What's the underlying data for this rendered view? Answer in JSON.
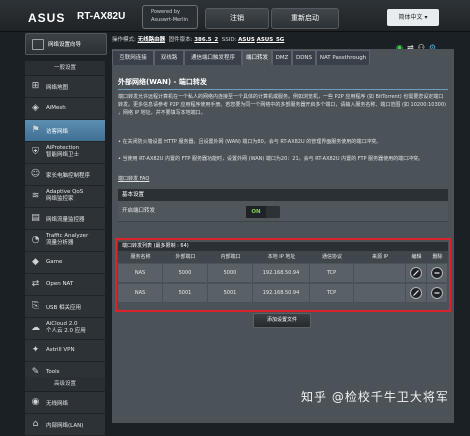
{
  "header": {
    "logo": "ASUS",
    "model": "RT-AX82U",
    "powered_by_line1": "Powered by",
    "powered_by_line2": "Asuswrt-Merlin",
    "logout": "注销",
    "reboot": "重新启动",
    "language": "简体中文"
  },
  "status": {
    "op_mode_label": "操作模式:",
    "op_mode_value": "无线路由器",
    "firmware_label": "固件版本:",
    "firmware_value": "386.5_2",
    "ssid_label": "SSID:",
    "ssid1": "ASUS",
    "ssid2": "ASUS_5G",
    "icons": [
      "wifi-icon",
      "usb-icon",
      "link-icon",
      "settings-icon"
    ]
  },
  "sidebar": {
    "qis": "网络设置向导",
    "general_header": "一般设置",
    "general": [
      {
        "label": "网络地图",
        "icon": "network-map-icon"
      },
      {
        "label": "AiMesh",
        "icon": "aimesh-icon"
      },
      {
        "label": "访客网络",
        "icon": "guest-network-icon"
      },
      {
        "label": "AiProtection|智能网络卫士",
        "icon": "aiprotection-icon"
      },
      {
        "label": "家长电脑控制程序",
        "icon": "parental-control-icon"
      },
      {
        "label": "Adaptive QoS|网络监控家",
        "icon": "qos-icon"
      },
      {
        "label": "网络流量监控器",
        "icon": "traffic-monitor-icon"
      },
      {
        "label": "Traffic Analyzer|流量分析器",
        "icon": "traffic-analyzer-icon"
      },
      {
        "label": "Game",
        "icon": "game-icon"
      },
      {
        "label": "Open NAT",
        "icon": "open-nat-icon"
      },
      {
        "label": "USB 相关应用",
        "icon": "usb-app-icon"
      },
      {
        "label": "AiCloud 2.0|个人云 2.0 应用",
        "icon": "aicloud-icon"
      },
      {
        "label": "Astrill VPN",
        "icon": "vpn-icon"
      },
      {
        "label": "Tools",
        "icon": "tools-icon"
      }
    ],
    "advanced_header": "高级设置",
    "advanced": [
      {
        "label": "无线网络",
        "icon": "wireless-icon"
      },
      {
        "label": "内部网络(LAN)",
        "icon": "lan-icon"
      }
    ]
  },
  "tabs": [
    "互联网连接",
    "双线路",
    "通信端口触发程序",
    "端口转发",
    "DMZ",
    "DDNS",
    "NAT Passthrough"
  ],
  "page": {
    "title": "外部网络(WAN) - 端口转发",
    "intro": "端口转发允许远程计算机在一个私人的网络内连接至一个具体的计算机或服务。例如浏览机，一些 P2P 应用程序 (如 BitTorrent) 也需要您设定端口转发。更多信息请参考 P2P 应用程序使用手册。若您要为同一个网络中的多部服务器开启多个端口，请输入服务名称、端口范围 (如 10200:10300) ，网络 IP 地址，并不要填写本地端口。",
    "bullet1": "• 在关闭防火墙设置 HTTP 服务器，且设置外网 (WAN) 端口为80，会与 RT-AX82U 的管理界面服务使用的端口冲突。",
    "bullet2": "• 当使用 RT-AX82U 内置的 FTP 服务器功能时，设置外网 (WAN) 端口为20：21，会与 RT-AX82U 内置的 FTP 服务器使用的端口冲突。",
    "faq": "端口转发 FAQ",
    "basic_config": "基本设置",
    "enable_label": "开启端口转发",
    "toggle_state": "ON"
  },
  "table": {
    "title": "端口转发列表 (最多限制 : 64)",
    "columns": [
      "服务名称",
      "外部端口",
      "内部端口",
      "本地 IP 地址",
      "通信协议",
      "来源 IP",
      "编辑",
      "删除"
    ],
    "rows": [
      {
        "service": "NAS",
        "external": "5000",
        "internal": "5000",
        "ip": "192.168.50.94",
        "protocol": "TCP",
        "source": ""
      },
      {
        "service": "NAS",
        "external": "5001",
        "internal": "5001",
        "ip": "192.168.50.94",
        "protocol": "TCP",
        "source": ""
      }
    ],
    "add_button": "添加设置文件"
  },
  "watermark": "知乎 @检校千牛卫大将军"
}
